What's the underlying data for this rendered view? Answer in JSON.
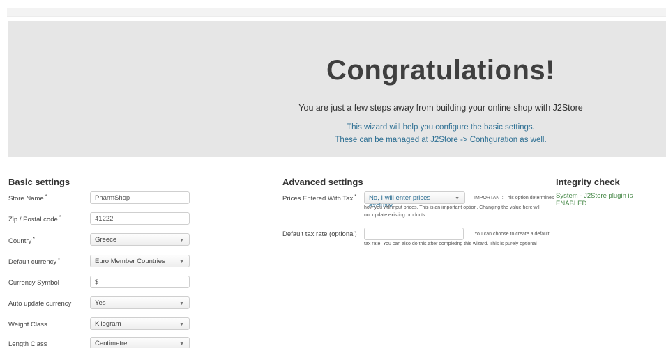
{
  "hero": {
    "title": "Congratulations!",
    "subtitle": "You are just a few steps away from building your online shop with J2Store",
    "help_line1": "This wizard will help you configure the basic settings.",
    "help_line2": "These can be managed at J2Store -> Configuration as well."
  },
  "basic": {
    "heading": "Basic settings",
    "store_name": {
      "label": "Store Name",
      "required": "*",
      "value": "PharmShop"
    },
    "zip": {
      "label": "Zip / Postal code",
      "required": "*",
      "value": "41222"
    },
    "country": {
      "label": "Country",
      "required": "*",
      "value": "Greece"
    },
    "currency": {
      "label": "Default currency",
      "required": "*",
      "value": "Euro Member Countries"
    },
    "currency_symbol": {
      "label": "Currency Symbol",
      "value": "$"
    },
    "auto_update": {
      "label": "Auto update currency",
      "value": "Yes"
    },
    "weight_class": {
      "label": "Weight Class",
      "value": "Kilogram"
    },
    "length_class": {
      "label": "Length Class",
      "value": "Centimetre"
    }
  },
  "advanced": {
    "heading": "Advanced settings",
    "prices_tax": {
      "label": "Prices Entered With Tax",
      "required": "*",
      "value": "No, I will enter prices exclusiv...",
      "note1": "IMPORTANT: This option determines",
      "note2": "how you will input prices. This is an important option. Changing the value here will",
      "note3": "not update existing products"
    },
    "tax_rate": {
      "label": "Default tax rate (optional)",
      "value": "",
      "note1": "You can choose to create a default",
      "note2": "tax rate. You can also do this after completing this wizard. This is purely optional"
    }
  },
  "integrity": {
    "heading": "Integrity check",
    "status": "System - J2Store plugin is ENABLED."
  },
  "icons": {
    "caret": "chevron-down-icon"
  }
}
